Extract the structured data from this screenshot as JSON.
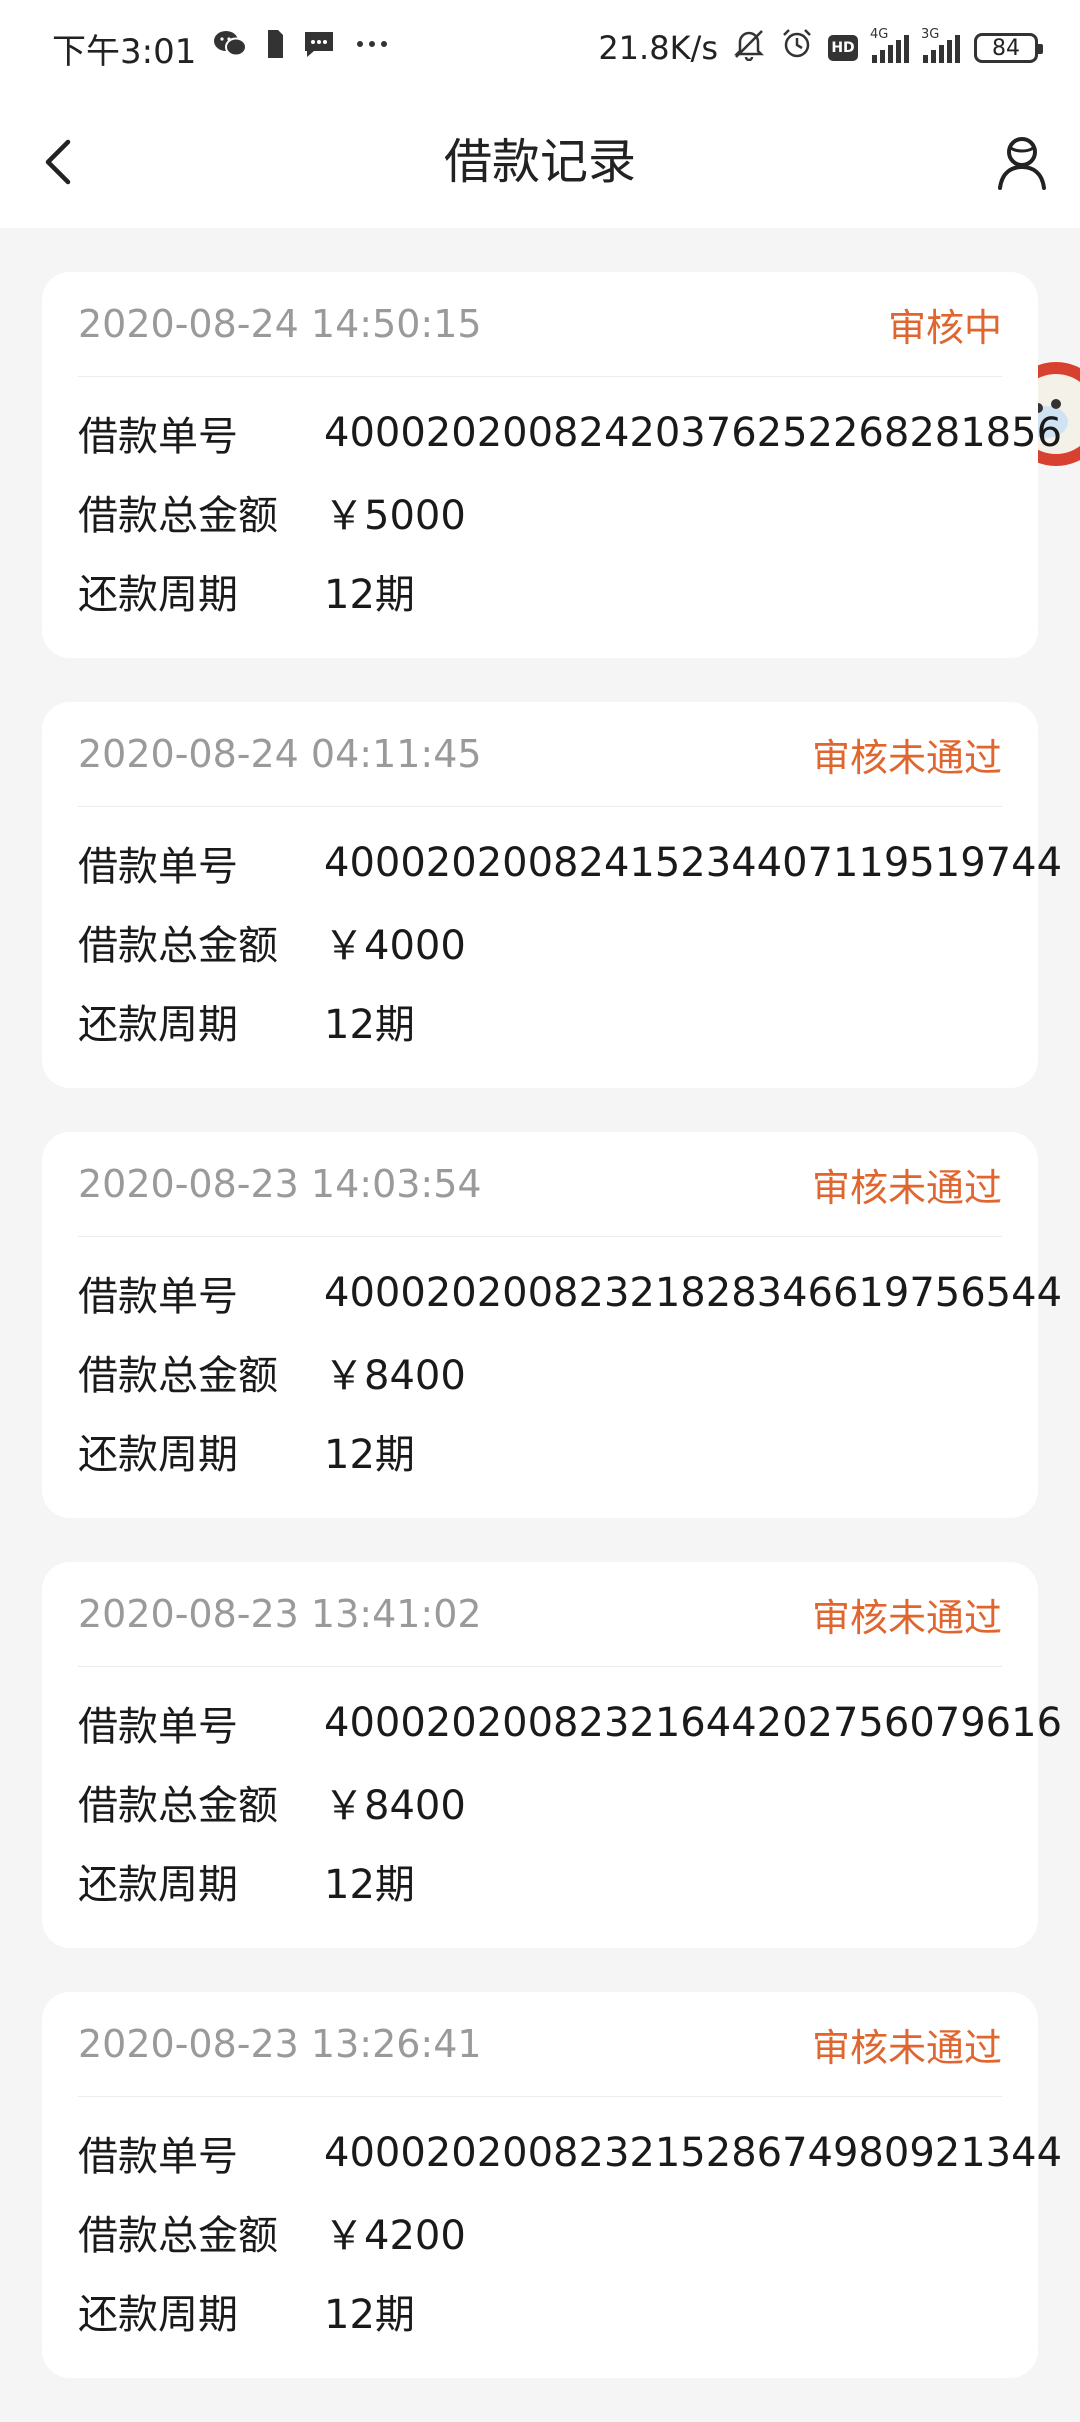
{
  "status_bar": {
    "time": "下午3:01",
    "net_speed": "21.8K/s",
    "hd": "HD",
    "signal_1_tag": "4G",
    "signal_2_tag": "3G",
    "battery": "84",
    "icons": [
      "wechat-icon",
      "sim-icon",
      "message-icon",
      "more-dots-icon",
      "mute-bell-icon",
      "alarm-icon"
    ]
  },
  "header": {
    "title": "借款记录",
    "back_icon": "chevron-left-icon",
    "profile_icon": "user-icon"
  },
  "labels": {
    "order_no": "借款单号",
    "total_amount": "借款总金额",
    "period": "还款周期"
  },
  "records": [
    {
      "time": "2020-08-24 14:50:15",
      "status": "审核中",
      "order_no": "40002020082420376252268281856",
      "amount": "￥5000",
      "period": "12期"
    },
    {
      "time": "2020-08-24 04:11:45",
      "status": "审核未通过",
      "order_no": "40002020082415234407119519744",
      "amount": "￥4000",
      "period": "12期"
    },
    {
      "time": "2020-08-23 14:03:54",
      "status": "审核未通过",
      "order_no": "40002020082321828346619756544",
      "amount": "￥8400",
      "period": "12期"
    },
    {
      "time": "2020-08-23 13:41:02",
      "status": "审核未通过",
      "order_no": "40002020082321644202756079616",
      "amount": "￥8400",
      "period": "12期"
    },
    {
      "time": "2020-08-23 13:26:41",
      "status": "审核未通过",
      "order_no": "40002020082321528674980921344",
      "amount": "￥4200",
      "period": "12期"
    }
  ],
  "colors": {
    "status": "#e0662f",
    "time": "#9a9a9a",
    "background": "#f5f5f5"
  }
}
